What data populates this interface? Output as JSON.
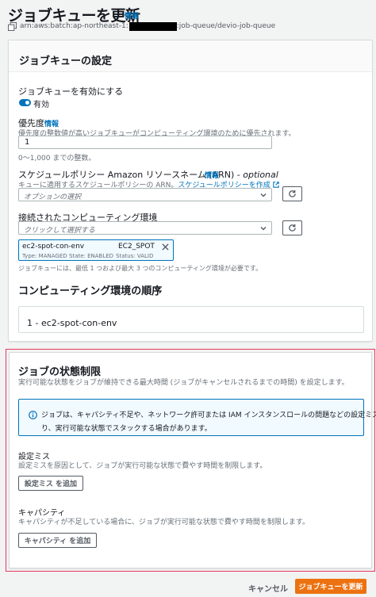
{
  "header": {
    "title": "ジョブキューを更新",
    "info": "情報",
    "arn_prefix": "arn:aws:batch:ap-northeast-1:",
    "arn_suffix": ":job-queue/devio-job-queue"
  },
  "settings": {
    "heading": "ジョブキューの設定",
    "enable_label": "ジョブキューを有効にする",
    "enable_value": "有効",
    "priority_label": "優先度",
    "priority_info": "情報",
    "priority_desc": "優先度の整数値が高いジョブキューがコンピューティング環境のために優先されます。",
    "priority_value": "1",
    "priority_hint": "0～1,000 までの整数。",
    "policy_label": "スケジュールポリシー Amazon リソースネーム (ARN) - ",
    "policy_optional": "optional",
    "policy_info": "情報",
    "policy_desc": "キューに適用するスケジュールポリシーの ARN。",
    "policy_create_link": "スケジュールポリシーを作成",
    "policy_placeholder": "オプションの選択",
    "compute_label": "接続されたコンピューティング環境",
    "compute_placeholder": "クリックして選択する",
    "token": {
      "name": "ec2-spot-con-env",
      "type_tag": "EC2_SPOT",
      "meta_type": "Type: MANAGED",
      "meta_state": "State: ENABLED",
      "meta_status": "Status: VALID"
    },
    "compute_hint": "ジョブキューには、最低 1 つおよび最大 3 つのコンピューティング環境が必要です。",
    "order_heading": "コンピューティング環境の順序",
    "order_item": "1 - ec2-spot-con-env"
  },
  "state_limit": {
    "heading": "ジョブの状態制限",
    "desc": "実行可能な状態をジョブが維持できる最大時間 (ジョブがキャンセルされるまでの時間) を設定します。",
    "alert_line1": "ジョブは、キャパシティ不足や、ネットワーク許可または IAM インスタンスロールの問題などの設定ミスによ",
    "alert_line2": "り、実行可能な状態でスタックする場合があります。",
    "misconfig_label": "設定ミス",
    "misconfig_desc": "設定ミスを原因として、ジョブが実行可能な状態で費やす時間を制限します。",
    "misconfig_button": "設定ミス を追加",
    "capacity_label": "キャパシティ",
    "capacity_desc": "キャパシティが不足している場合に、ジョブが実行可能な状態で費やす時間を制限します。",
    "capacity_button": "キャパシティ を追加"
  },
  "footer": {
    "cancel": "キャンセル",
    "submit": "ジョブキューを更新"
  },
  "colors": {
    "accent": "#0073bb",
    "primary": "#ec7211",
    "highlight": "#e8385f"
  }
}
